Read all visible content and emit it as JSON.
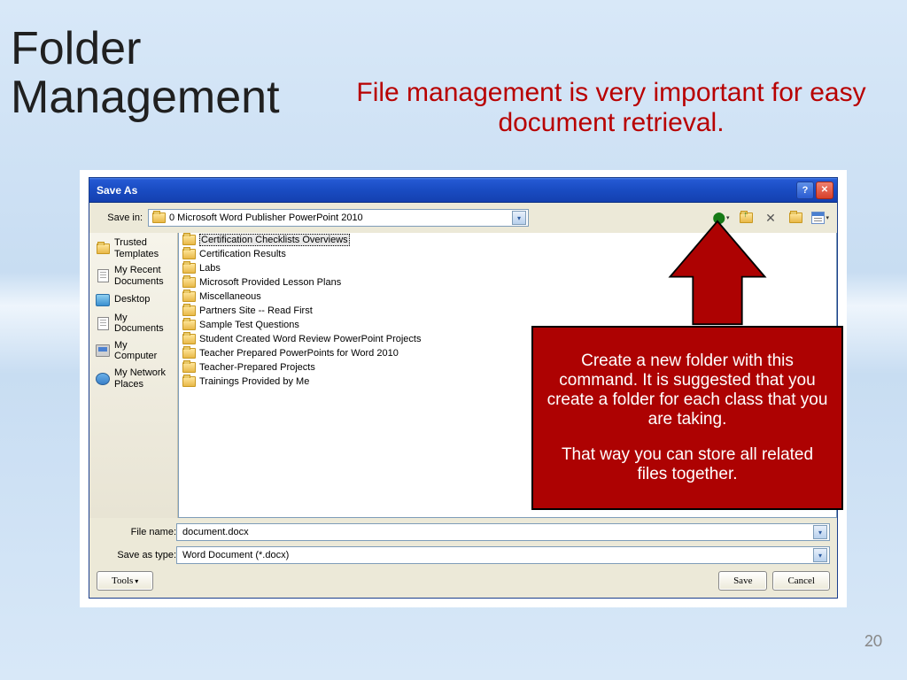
{
  "slide": {
    "title_line1": "Folder",
    "title_line2": "Management",
    "subtitle": "File management is very important for easy document retrieval.",
    "page_number": "20"
  },
  "dialog": {
    "title": "Save As",
    "save_in_label": "Save in:",
    "save_in_value": "0 Microsoft Word Publisher PowerPoint 2010",
    "file_name_label": "File name:",
    "file_name_value": "document.docx",
    "save_type_label": "Save as type:",
    "save_type_value": "Word Document (*.docx)",
    "tools_btn": "Tools",
    "save_btn": "Save",
    "cancel_btn": "Cancel"
  },
  "places": [
    {
      "label": "Trusted Templates",
      "icon": "folder"
    },
    {
      "label": "My Recent Documents",
      "icon": "doc"
    },
    {
      "label": "Desktop",
      "icon": "desktop"
    },
    {
      "label": "My Documents",
      "icon": "doc"
    },
    {
      "label": "My Computer",
      "icon": "computer"
    },
    {
      "label": "My Network Places",
      "icon": "network"
    }
  ],
  "folders": [
    "Certification Checklists Overviews",
    "Certification Results",
    "Labs",
    "Microsoft Provided Lesson Plans",
    "Miscellaneous",
    "Partners Site -- Read First",
    "Sample Test Questions",
    "Student Created Word Review  PowerPoint Projects",
    "Teacher Prepared PowerPoints for Word 2010",
    "Teacher-Prepared Projects",
    "Trainings Provided by Me"
  ],
  "callout": {
    "p1": "Create a new folder with this command. It is suggested that you create a folder for each class that you are taking.",
    "p2": "That way you can store all related files together."
  }
}
